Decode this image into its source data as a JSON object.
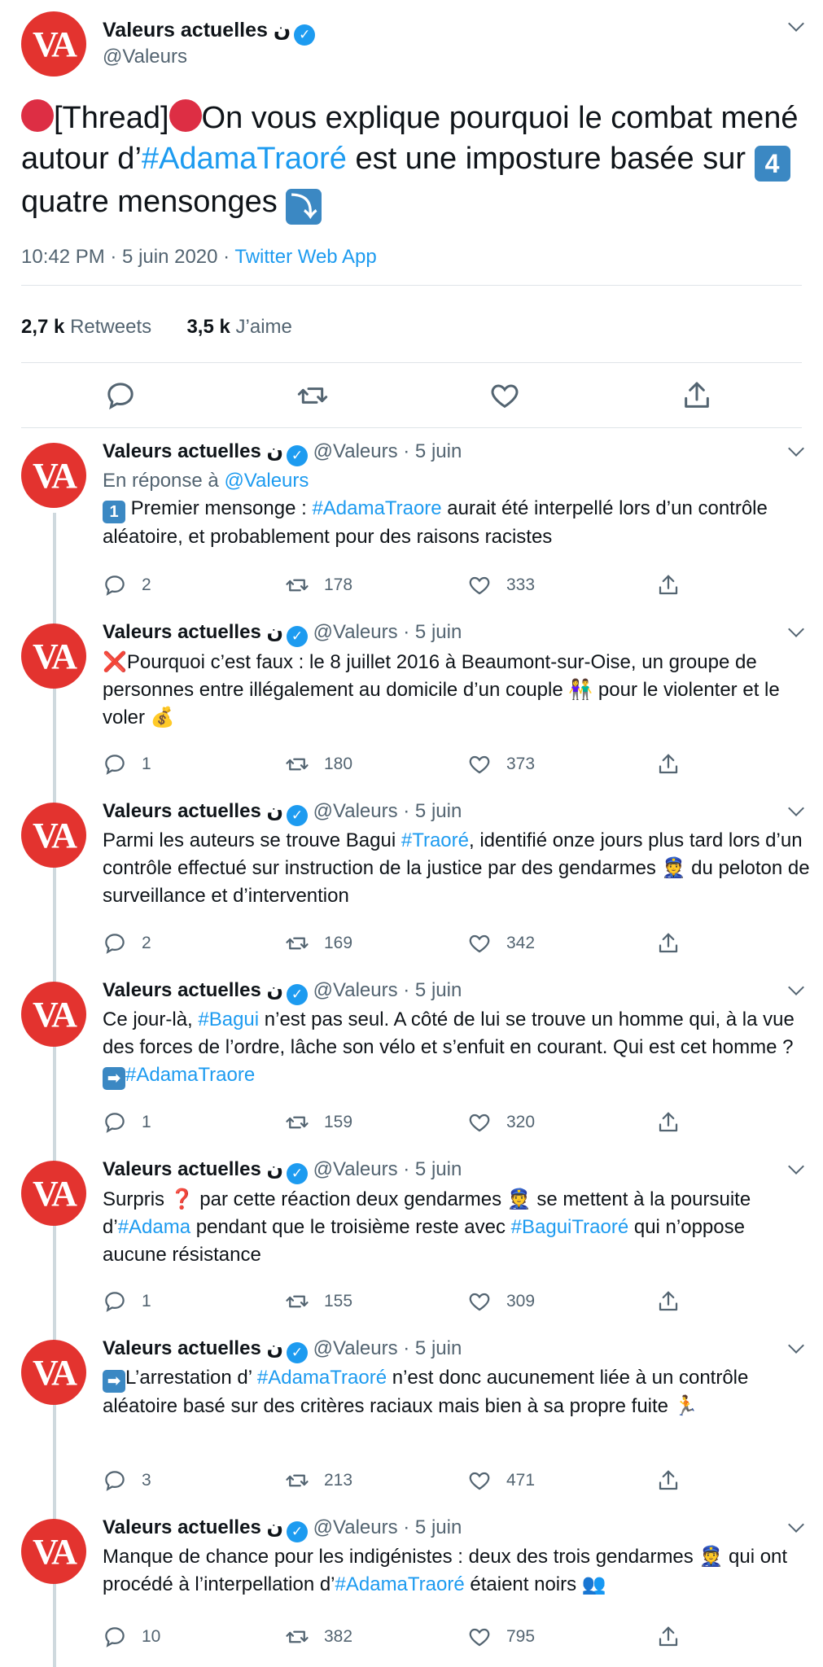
{
  "account": {
    "display_name": "Valeurs actuelles ن",
    "handle": "@Valeurs",
    "avatar_text": "VA",
    "verified_glyph": "✓"
  },
  "main_tweet": {
    "segments": [
      {
        "t": "[Thread]",
        "c": ""
      },
      {
        "t": "On vous explique pourquoi le combat mené autour d’",
        "c": ""
      },
      {
        "t": "#AdamaTraoré",
        "c": "blue"
      },
      {
        "t": " est une imposture basée sur ",
        "c": ""
      },
      {
        "t": "4",
        "c": "sq"
      },
      {
        "t": " quatre mensonges ",
        "c": ""
      },
      {
        "t": "⤵",
        "c": "sq"
      }
    ],
    "meta_time": "10:42 PM · 5 juin 2020 · ",
    "meta_source": "Twitter Web App",
    "retweets_count": "2,7 k",
    "retweets_label": "Retweets",
    "likes_count": "3,5 k",
    "likes_label": "J’aime"
  },
  "thread": [
    {
      "date": "5 juin",
      "reply_prefix": "En réponse à ",
      "reply_to": "@Valeurs",
      "segments": [
        {
          "t": "1",
          "c": "sq"
        },
        {
          "t": " Premier mensonge : ",
          "c": ""
        },
        {
          "t": "#AdamaTraore",
          "c": "blue"
        },
        {
          "t": " aurait été interpellé lors d’un contrôle aléatoire, et probablement pour des raisons racistes",
          "c": ""
        }
      ],
      "replies": "2",
      "retweets": "178",
      "likes": "333"
    },
    {
      "date": "5 juin",
      "segments": [
        {
          "t": "❌",
          "c": "emo-red"
        },
        {
          "t": "Pourquoi c’est faux : le 8 juillet 2016 à Beaumont-sur-Oise, un groupe de personnes entre illégalement au domicile d’un couple 👫 pour le violenter et le voler 💰",
          "c": ""
        }
      ],
      "replies": "1",
      "retweets": "180",
      "likes": "373"
    },
    {
      "date": "5 juin",
      "segments": [
        {
          "t": "Parmi les auteurs se trouve Bagui ",
          "c": ""
        },
        {
          "t": "#Traoré",
          "c": "blue"
        },
        {
          "t": ", identifié onze jours plus tard lors d’un contrôle effectué sur instruction de la justice par des gendarmes 👮 du peloton de surveillance et d’intervention",
          "c": ""
        }
      ],
      "replies": "2",
      "retweets": "169",
      "likes": "342"
    },
    {
      "date": "5 juin",
      "segments": [
        {
          "t": "Ce jour-là, ",
          "c": ""
        },
        {
          "t": "#Bagui",
          "c": "blue"
        },
        {
          "t": " n’est pas seul. A côté de lui se trouve un homme qui, à la vue des forces de l’ordre, lâche son vélo et s’enfuit en courant. Qui est cet homme ? ",
          "c": ""
        },
        {
          "t": "➡",
          "c": "sq"
        },
        {
          "t": "#AdamaTraore",
          "c": "blue"
        }
      ],
      "replies": "1",
      "retweets": "159",
      "likes": "320"
    },
    {
      "date": "5 juin",
      "segments": [
        {
          "t": "Surpris ",
          "c": ""
        },
        {
          "t": "❓",
          "c": "emo-red"
        },
        {
          "t": " par cette réaction deux gendarmes 👮 se mettent à la poursuite d’",
          "c": ""
        },
        {
          "t": "#Adama",
          "c": "blue"
        },
        {
          "t": " pendant que le troisième reste avec ",
          "c": ""
        },
        {
          "t": "#BaguiTraoré",
          "c": "blue"
        },
        {
          "t": " qui n’oppose aucune résistance",
          "c": ""
        }
      ],
      "replies": "1",
      "retweets": "155",
      "likes": "309"
    },
    {
      "date": "5 juin",
      "segments": [
        {
          "t": "➡",
          "c": "sq"
        },
        {
          "t": "L’arrestation d’ ",
          "c": ""
        },
        {
          "t": "#AdamaTraoré",
          "c": "blue"
        },
        {
          "t": " n’est donc aucunement liée à un contrôle aléatoire basé sur des critères raciaux mais bien à sa propre fuite 🏃",
          "c": ""
        }
      ],
      "replies": "3",
      "retweets": "213",
      "likes": "471"
    },
    {
      "date": "5 juin",
      "segments": [
        {
          "t": "Manque de chance pour les indigénistes : deux des trois gendarmes 👮 qui ont procédé à l’interpellation d’",
          "c": ""
        },
        {
          "t": "#AdamaTraoré",
          "c": "blue"
        },
        {
          "t": " étaient noirs 👥",
          "c": ""
        }
      ],
      "replies": "10",
      "retweets": "382",
      "likes": "795"
    }
  ],
  "icons": {
    "reply": "reply-icon",
    "retweet": "retweet-icon",
    "like": "heart-icon",
    "share": "share-icon",
    "more": "chevron-down-icon"
  },
  "colors": {
    "accent": "#1d9bf0",
    "avatar_bg": "#e3332f",
    "thread_line": "#cfd9de",
    "secondary_text": "#536471"
  }
}
